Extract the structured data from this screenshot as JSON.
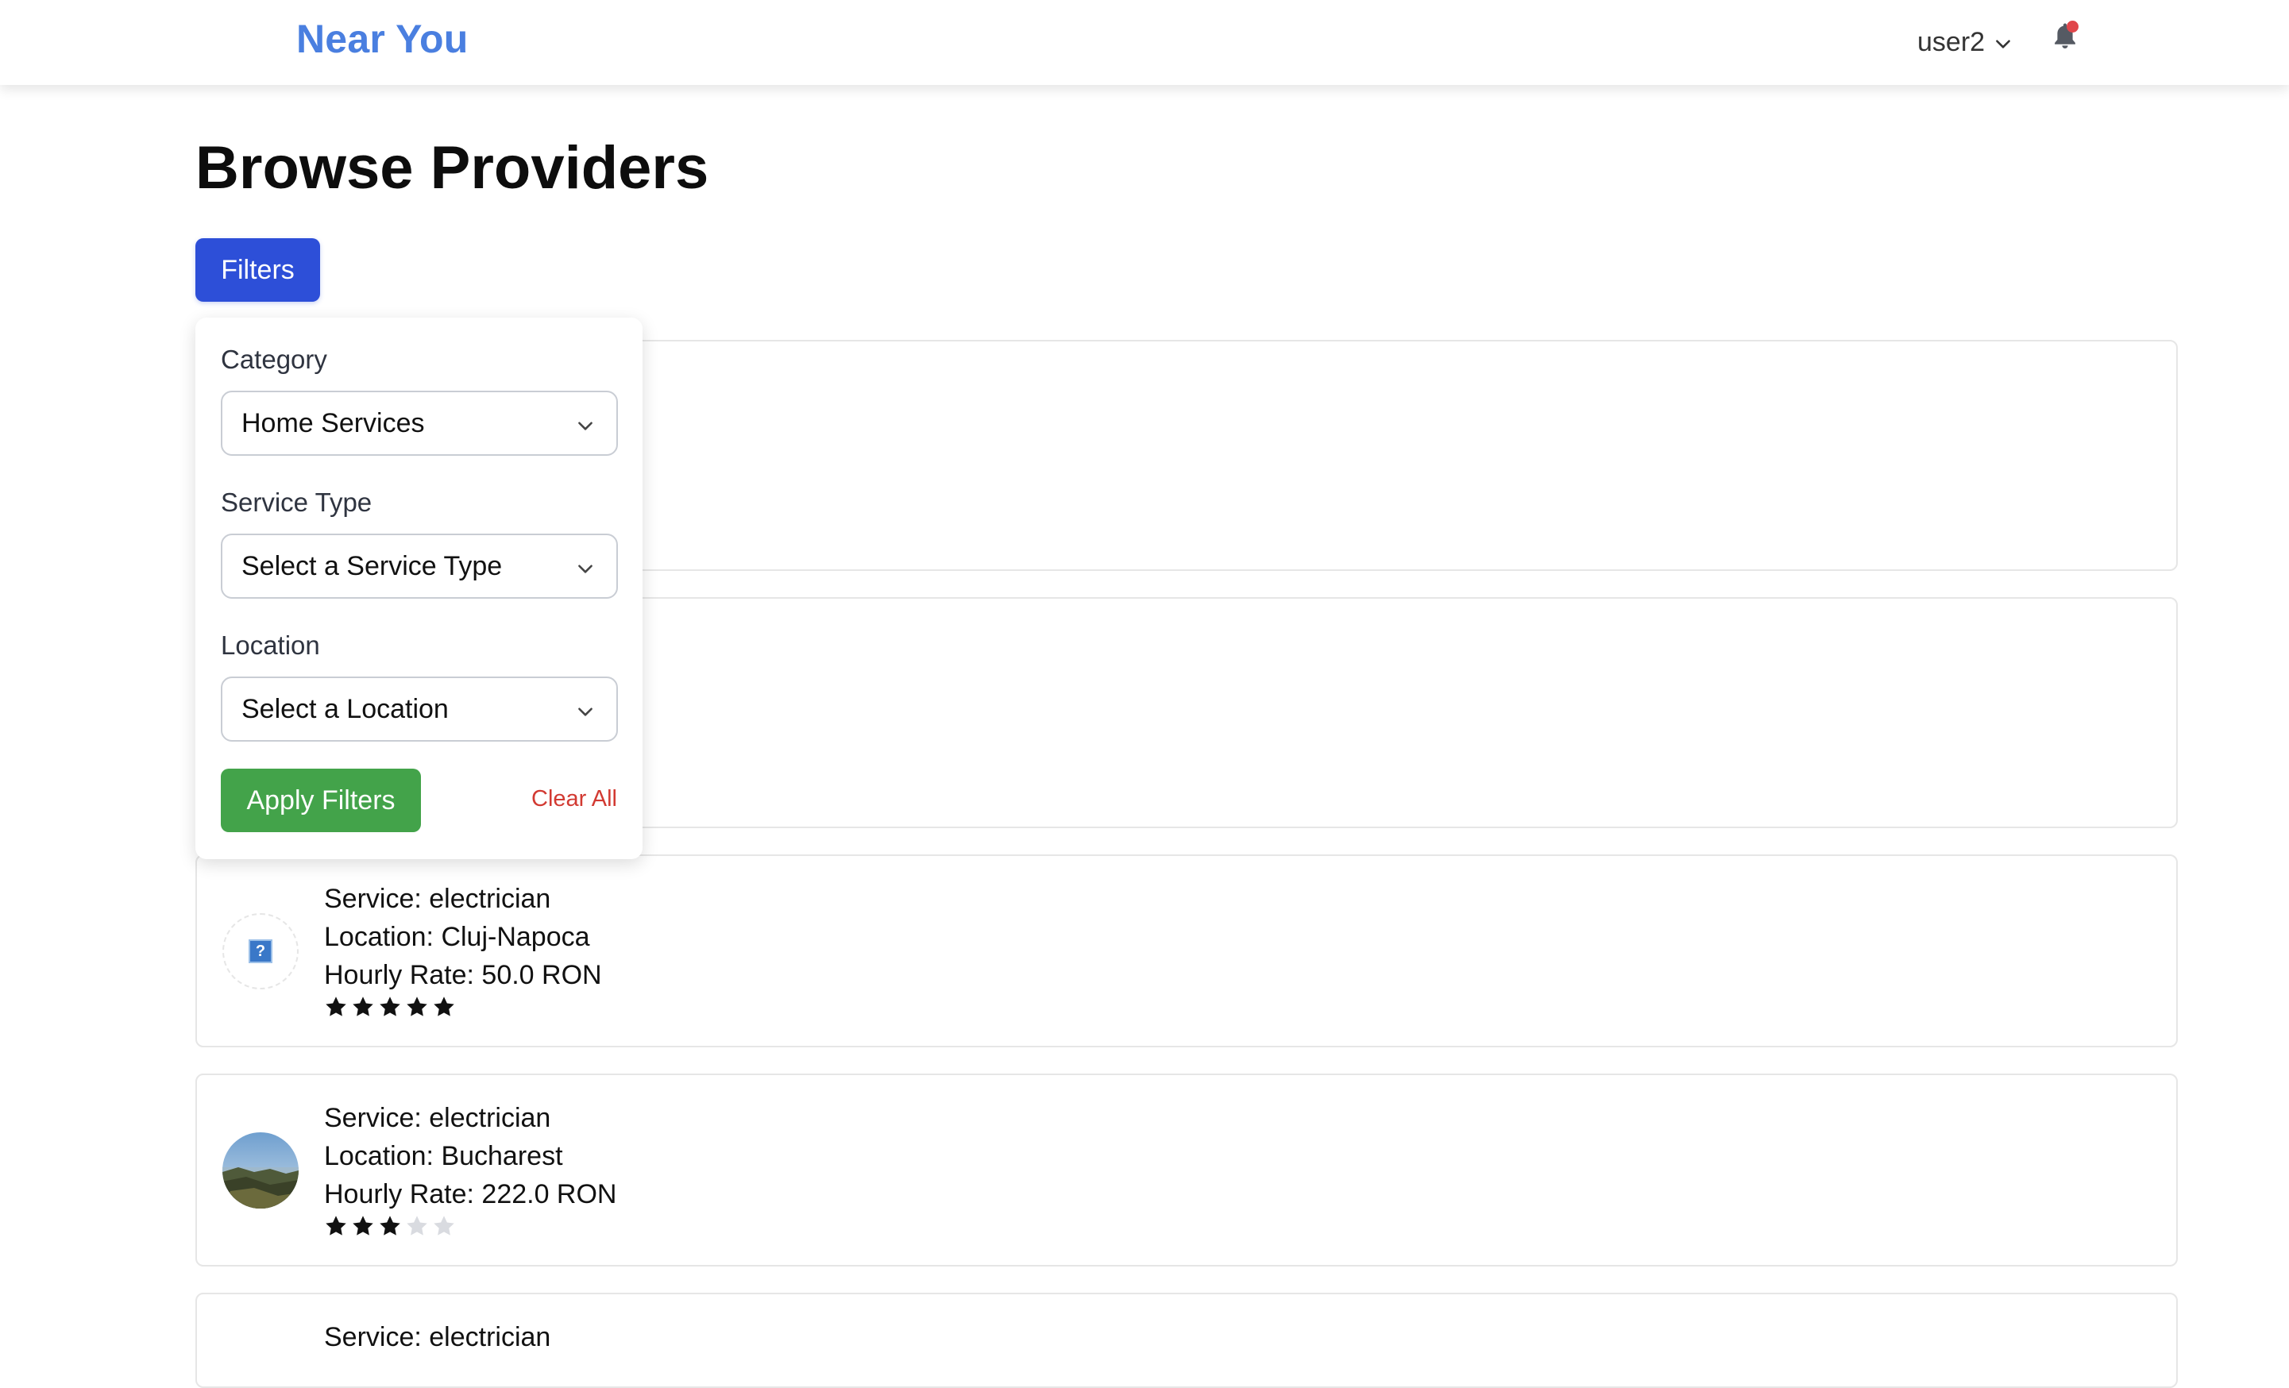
{
  "header": {
    "brand": "Near You",
    "user": "user2"
  },
  "page": {
    "title": "Browse Providers",
    "filters_button": "Filters"
  },
  "filter_panel": {
    "category_label": "Category",
    "category_value": "Home Services",
    "service_type_label": "Service Type",
    "service_type_value": "Select a Service Type",
    "location_label": "Location",
    "location_value": "Select a Location",
    "apply_label": "Apply Filters",
    "clear_label": "Clear All"
  },
  "providers": [
    {
      "service": "Service: electrician",
      "location": "Location: Cluj-Napoca",
      "rate": "Hourly Rate: 50.0 RON",
      "rating": 5,
      "rating_max": 5,
      "avatar": "broken-image-icon"
    },
    {
      "service": "Service: electrician",
      "location": "Location: Bucharest",
      "rate": "Hourly Rate: 222.0 RON",
      "rating": 3,
      "rating_max": 5,
      "avatar": "landscape-photo"
    },
    {
      "service": "Service: electrician"
    }
  ],
  "colors": {
    "brand": "#4a7fe0",
    "filters_button": "#2d4fd8",
    "apply_button": "#43a34a",
    "clear_link": "#d23a32",
    "notification_dot": "#e0464b",
    "star_filled": "#111111",
    "star_empty": "#d9dbe0"
  },
  "icons": {
    "user_menu": "chevron-down-icon",
    "notifications": "bell-icon",
    "select": "chevron-down-icon",
    "rating": "star-icon"
  }
}
